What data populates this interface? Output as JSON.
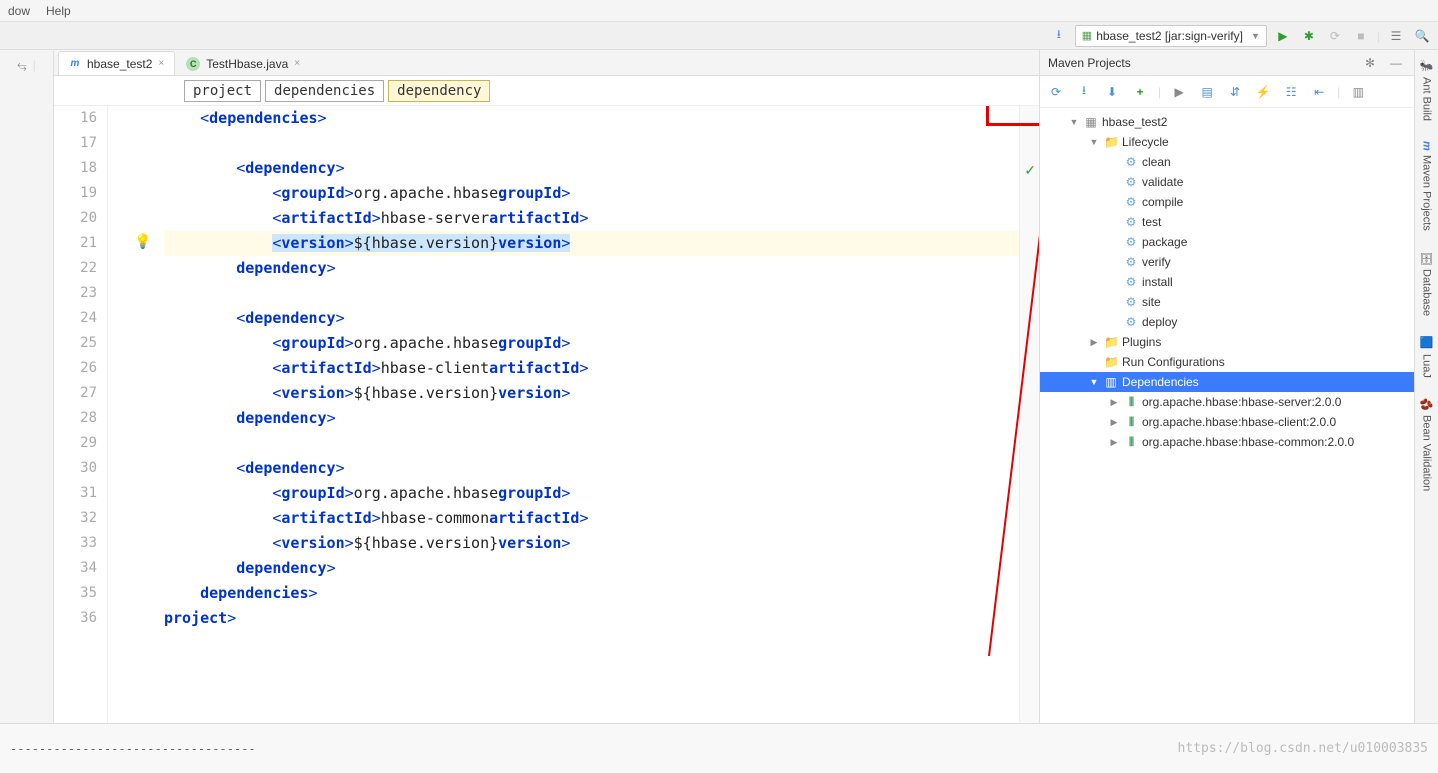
{
  "menu": {
    "window": "dow",
    "help": "Help"
  },
  "run_config": "hbase_test2 [jar:sign-verify]",
  "tabs": [
    {
      "label": "hbase_test2",
      "icon": "m",
      "icon_color": "#3b7cff",
      "active": true
    },
    {
      "label": "TestHbase.java",
      "icon": "C",
      "icon_color": "#3ea055",
      "active": false
    }
  ],
  "breadcrumb": [
    "project",
    "dependencies",
    "dependency"
  ],
  "lines": [
    16,
    17,
    18,
    19,
    20,
    21,
    22,
    23,
    24,
    25,
    26,
    27,
    28,
    29,
    30,
    31,
    32,
    33,
    34,
    35,
    36
  ],
  "code": {
    "l16": {
      "i": 1,
      "o": "<",
      "t": "dependencies",
      "c": ">"
    },
    "l18": {
      "i": 2,
      "o": "<",
      "t": "dependency",
      "c": ">"
    },
    "l19": {
      "i": 3,
      "o": "<",
      "t": "groupId",
      "c": ">",
      "txt": "org.apache.hbase",
      "o2": "</",
      "t2": "groupId",
      "c2": ">"
    },
    "l20": {
      "i": 3,
      "o": "<",
      "t": "artifactId",
      "c": ">",
      "txt": "hbase-server",
      "o2": "</",
      "t2": "artifactId",
      "c2": ">"
    },
    "l21": {
      "i": 3,
      "o": "<",
      "t": "version",
      "c": ">",
      "txt": "${hbase.version}",
      "o2": "</",
      "t2": "version",
      "c2": ">"
    },
    "l22": {
      "i": 2,
      "o": "</",
      "t": "dependency",
      "c": ">"
    },
    "l24": {
      "i": 2,
      "o": "<",
      "t": "dependency",
      "c": ">"
    },
    "l25": {
      "i": 3,
      "o": "<",
      "t": "groupId",
      "c": ">",
      "txt": "org.apache.hbase",
      "o2": "</",
      "t2": "groupId",
      "c2": ">"
    },
    "l26": {
      "i": 3,
      "o": "<",
      "t": "artifactId",
      "c": ">",
      "txt": "hbase-client",
      "o2": "</",
      "t2": "artifactId",
      "c2": ">"
    },
    "l27": {
      "i": 3,
      "o": "<",
      "t": "version",
      "c": ">",
      "txt": "${hbase.version}",
      "o2": "</",
      "t2": "version",
      "c2": ">"
    },
    "l28": {
      "i": 2,
      "o": "</",
      "t": "dependency",
      "c": ">"
    },
    "l30": {
      "i": 2,
      "o": "<",
      "t": "dependency",
      "c": ">"
    },
    "l31": {
      "i": 3,
      "o": "<",
      "t": "groupId",
      "c": ">",
      "txt": "org.apache.hbase",
      "o2": "</",
      "t2": "groupId",
      "c2": ">"
    },
    "l32": {
      "i": 3,
      "o": "<",
      "t": "artifactId",
      "c": ">",
      "txt": "hbase-common",
      "o2": "</",
      "t2": "artifactId",
      "c2": ">"
    },
    "l33": {
      "i": 3,
      "o": "<",
      "t": "version",
      "c": ">",
      "txt": "${hbase.version}",
      "o2": "</",
      "t2": "version",
      "c2": ">"
    },
    "l34": {
      "i": 2,
      "o": "</",
      "t": "dependency",
      "c": ">"
    },
    "l35": {
      "i": 1,
      "o": "</",
      "t": "dependencies",
      "c": ">"
    },
    "l36": {
      "i": 0,
      "o": "</",
      "t": "project",
      "c": ">"
    }
  },
  "maven": {
    "title": "Maven Projects",
    "root": "hbase_test2",
    "lifecycle_label": "Lifecycle",
    "lifecycle": [
      "clean",
      "validate",
      "compile",
      "test",
      "package",
      "verify",
      "install",
      "site",
      "deploy"
    ],
    "plugins": "Plugins",
    "run_configs": "Run Configurations",
    "deps_label": "Dependencies",
    "deps": [
      "org.apache.hbase:hbase-server:2.0.0",
      "org.apache.hbase:hbase-client:2.0.0",
      "org.apache.hbase:hbase-common:2.0.0"
    ]
  },
  "side": {
    "ant": "Ant Build",
    "maven": "Maven Projects",
    "db": "Database",
    "lua": "LuaJ",
    "bean": "Bean Validation"
  },
  "bottom": {
    "dashes": "----------------------------------",
    "watermark": "https://blog.csdn.net/u010003835"
  }
}
